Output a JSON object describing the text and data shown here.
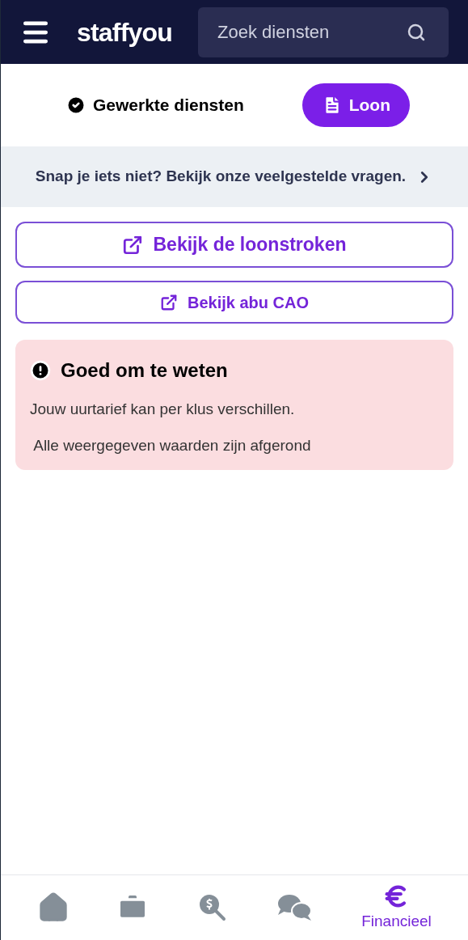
{
  "header": {
    "logo": "staffyou",
    "search": {
      "placeholder": "Zoek diensten"
    }
  },
  "tabs": [
    {
      "label": "Gewerkte diensten",
      "selected": false,
      "kind": "check"
    },
    {
      "label": "Loon",
      "selected": true,
      "kind": "payslip"
    }
  ],
  "faq_banner": {
    "text": "Snap je iets niet? Bekijk onze veelgestelde vragen."
  },
  "link_buttons": [
    {
      "label": "Bekijk de loonstroken",
      "kind": "primary"
    },
    {
      "label": "Bekijk abu CAO",
      "kind": "secondary"
    }
  ],
  "notice": {
    "title": "Goed om te weten",
    "lines": [
      "Jouw uurtarief kan per klus verschillen.",
      " Alle weergegeven waarden zijn afgerond"
    ]
  },
  "bottom_nav": [
    {
      "kind": "home",
      "selected": false
    },
    {
      "kind": "jobs",
      "selected": false
    },
    {
      "kind": "search_pay",
      "selected": false
    },
    {
      "kind": "chat",
      "selected": false
    },
    {
      "kind": "finance",
      "selected": true,
      "label": "Financieel"
    }
  ]
}
